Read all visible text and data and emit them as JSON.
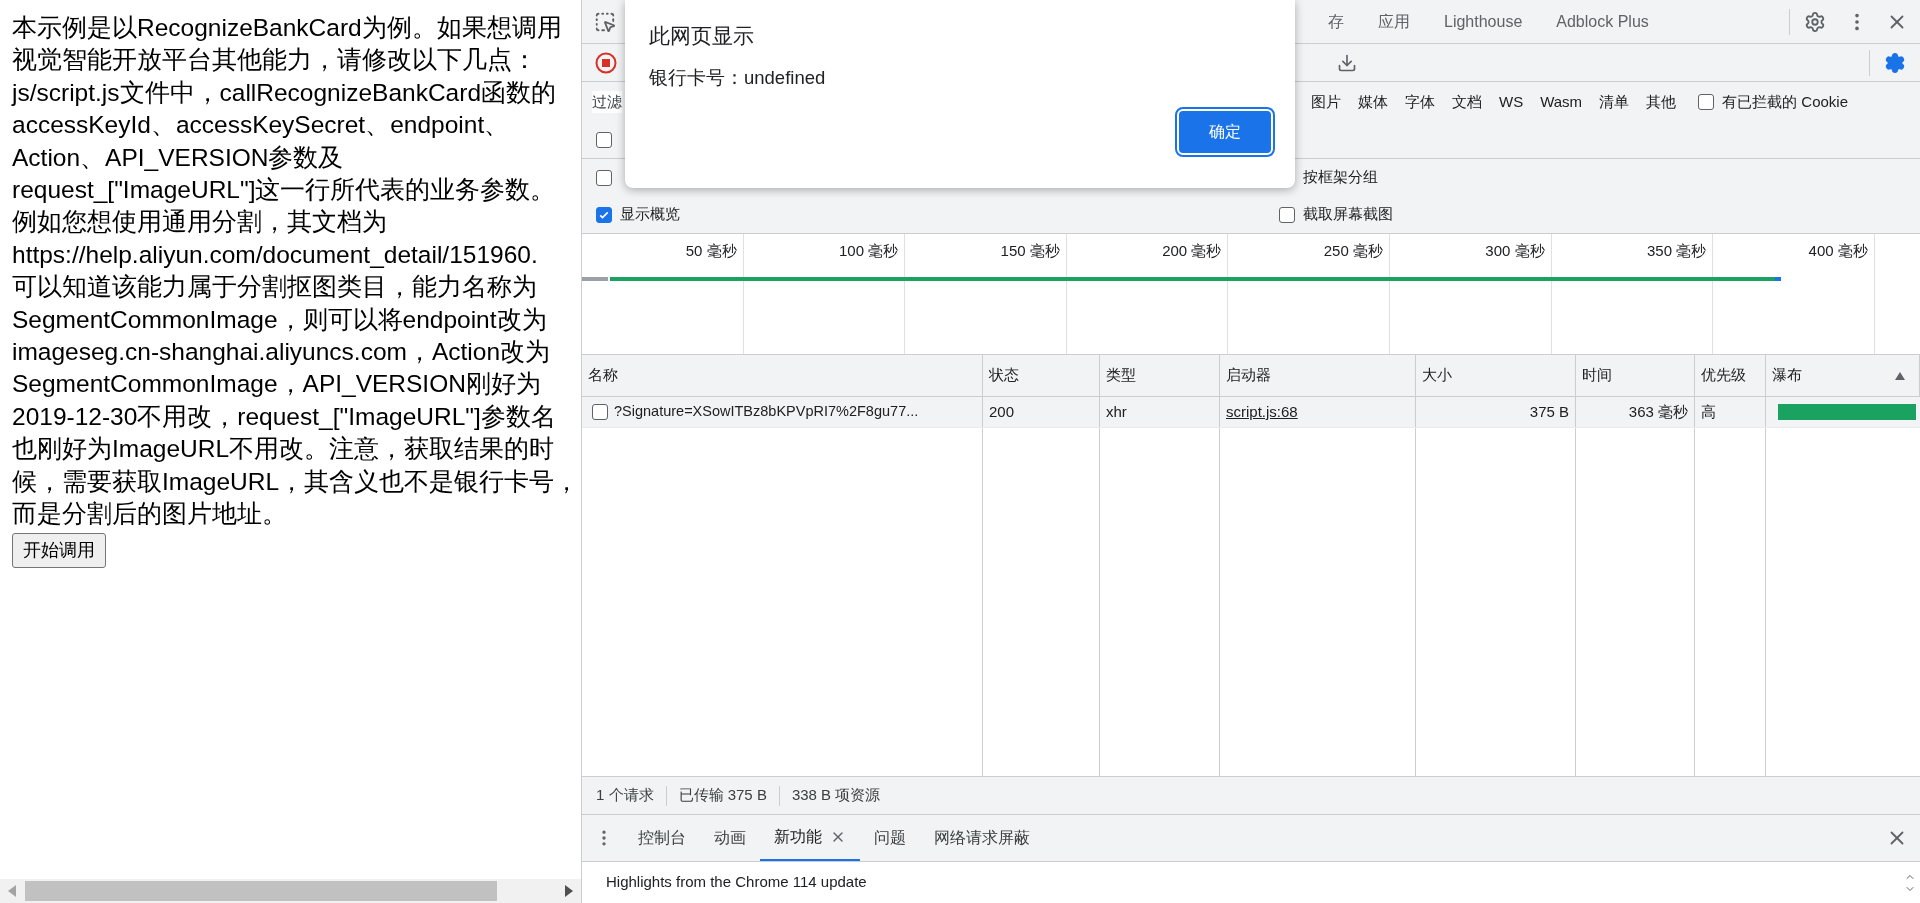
{
  "page": {
    "paragraph_lines": [
      "本示例是以RecognizeBankCard为例。如果想调用",
      "视觉智能开放平台其他能力，请修改以下几点：",
      "js/script.js文件中，callRecognizeBankCard函数的",
      "accessKeyId、accessKeySecret、endpoint、",
      "Action、API_VERSION参数及",
      "request_[\"ImageURL\"]这一行所代表的业务参数。",
      "例如您想使用通用分割，其文档为",
      "https://help.aliyun.com/document_detail/151960.",
      "可以知道该能力属于分割抠图类目，能力名称为",
      "SegmentCommonImage，则可以将endpoint改为",
      "imageseg.cn-shanghai.aliyuncs.com，Action改为",
      "SegmentCommonImage，API_VERSION刚好为",
      "2019-12-30不用改，request_[\"ImageURL\"]参数名",
      "也刚好为ImageURL不用改。注意，获取结果的时",
      "候，需要获取ImageURL，其含义也不是银行卡号，",
      "而是分割后的图片地址。"
    ],
    "button": "开始调用"
  },
  "devtools": {
    "main_tabs": [
      {
        "label": "存",
        "selected": false
      },
      {
        "label": "应用",
        "selected": false
      },
      {
        "label": "Lighthouse",
        "selected": false
      },
      {
        "label": "Adblock Plus",
        "selected": false
      }
    ],
    "filter_label": "过滤",
    "type_filters": [
      "图片",
      "媒体",
      "字体",
      "文档",
      "WS",
      "Wasm",
      "清单",
      "其他"
    ],
    "blocked_cookies": {
      "label": "有已拦截的 Cookie",
      "checked": false
    },
    "option_rows": [
      {
        "left": {
          "checked": false
        }
      },
      {
        "left": {
          "checked": false
        },
        "right": {
          "label": "按框架分组"
        }
      },
      {
        "left": {
          "label": "显示概览",
          "checked": true
        },
        "right": {
          "label": "截取屏幕截图",
          "checked": false
        }
      }
    ],
    "timeline_ticks": [
      "50 毫秒",
      "100 毫秒",
      "150 毫秒",
      "200 毫秒",
      "250 毫秒",
      "300 毫秒",
      "350 毫秒",
      "400 毫秒"
    ],
    "table": {
      "columns": [
        {
          "label": "名称",
          "sorted": false
        },
        {
          "label": "状态",
          "sorted": false
        },
        {
          "label": "类型",
          "sorted": false
        },
        {
          "label": "启动器",
          "sorted": false
        },
        {
          "label": "大小",
          "sorted": false
        },
        {
          "label": "时间",
          "sorted": false
        },
        {
          "label": "优先级",
          "sorted": false
        },
        {
          "label": "瀑布",
          "sorted": true
        }
      ],
      "rows": [
        {
          "checked": false,
          "name": "?Signature=XSowITBz8bKPVpRI7%2F8gu77...",
          "status": "200",
          "type": "xhr",
          "initiator": "script.js:68",
          "size": "375 B",
          "time": "363 毫秒",
          "priority": "高"
        }
      ]
    },
    "status_bar": [
      "1 个请求",
      "已传输 375 B",
      "338 B 项资源"
    ],
    "drawer": {
      "tabs": [
        {
          "label": "控制台",
          "selected": false,
          "closable": false
        },
        {
          "label": "动画",
          "selected": false,
          "closable": false
        },
        {
          "label": "新功能",
          "selected": true,
          "closable": true
        },
        {
          "label": "问题",
          "selected": false,
          "closable": false
        },
        {
          "label": "网络请求屏蔽",
          "selected": false,
          "closable": false
        }
      ],
      "content": "Highlights from the Chrome 114 update"
    }
  },
  "dialog": {
    "title": "此网页显示",
    "message": "银行卡号：undefined",
    "ok": "确定"
  }
}
